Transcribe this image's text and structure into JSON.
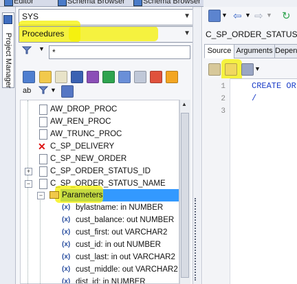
{
  "top_tabs": {
    "editor": "Editor",
    "schema_browser_1": "Schema Browser",
    "schema_browser_2": "Schema Browser"
  },
  "sidebar_tab": {
    "label": "Project Manager"
  },
  "schema_select": {
    "value": "SYS"
  },
  "object_type_select": {
    "value": "Procedures"
  },
  "filter": {
    "value": "*"
  },
  "tree": {
    "items": [
      {
        "label": "AW_DROP_PROC"
      },
      {
        "label": "AW_REN_PROC"
      },
      {
        "label": "AW_TRUNC_PROC"
      },
      {
        "label": "C_SP_DELIVERY"
      },
      {
        "label": "C_SP_NEW_ORDER"
      },
      {
        "label": "C_SP_ORDER_STATUS_ID"
      },
      {
        "label": "C_SP_ORDER_STATUS_NAME"
      },
      {
        "label": "Parameters"
      }
    ],
    "param_icon": "(x)",
    "params": [
      {
        "label": "bylastname: in NUMBER"
      },
      {
        "label": "cust_balance: out NUMBER"
      },
      {
        "label": "cust_first: out VARCHAR2"
      },
      {
        "label": "cust_id: in out NUMBER"
      },
      {
        "label": "cust_last: in out VARCHAR2"
      },
      {
        "label": "cust_middle: out VARCHAR2"
      },
      {
        "label": "dist_id: in NUMBER"
      }
    ]
  },
  "object_title": "C_SP_ORDER_STATUS_NAME",
  "detail_tabs": [
    "Source",
    "Arguments",
    "Dependencies"
  ],
  "editor": {
    "line_numbers": [
      "1",
      "2",
      "3"
    ],
    "lines": [
      "CREATE OR",
      "/",
      ""
    ]
  },
  "colors": {
    "highlight": "#f4f000",
    "selection": "#3399ff",
    "keyword": "#1a3cc8",
    "error_icon": "#dd1111"
  }
}
